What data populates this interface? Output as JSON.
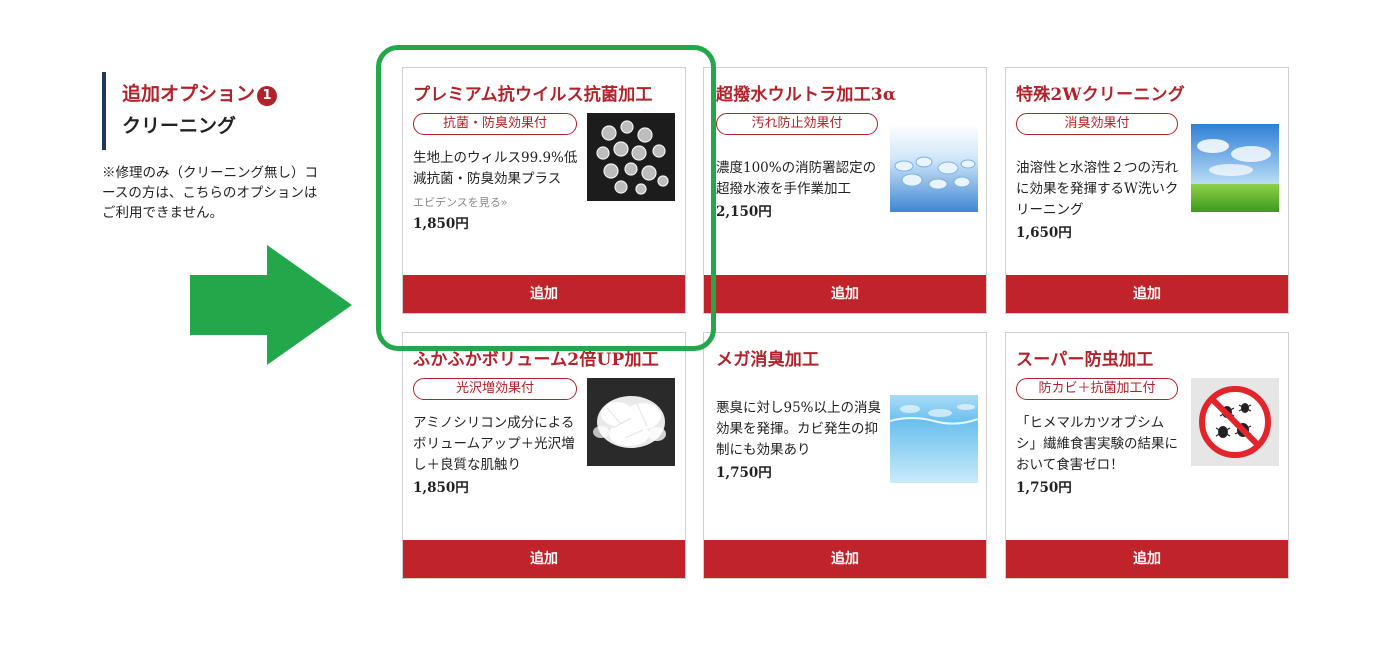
{
  "sidebar": {
    "title": "追加オプション",
    "number": "1",
    "subtitle": "クリーニング",
    "note": "※修理のみ（クリーニング無し）コースの方は、こちらのオプションはご利用できません。"
  },
  "options": [
    {
      "title": "プレミアム抗ウイルス抗菌加工",
      "badge": "抗菌・防臭効果付",
      "desc": "生地上のウィルス99.9%低減抗菌・防臭効果プラス",
      "evidence": "エビデンスを見る»",
      "price": "1,850円",
      "button": "追加",
      "image": "virus-microscope-image"
    },
    {
      "title": "超撥水ウルトラ加工3α",
      "badge": "汚れ防止効果付",
      "desc": "濃度100%の消防署認定の超撥水液を手作業加工",
      "price": "2,150円",
      "button": "追加",
      "image": "water-droplets-image"
    },
    {
      "title": "特殊2Wクリーニング",
      "badge": "消臭効果付",
      "desc": "油溶性と水溶性２つの汚れに効果を発揮するW洗いクリーニング",
      "price": "1,650円",
      "button": "追加",
      "image": "sky-grass-image"
    },
    {
      "title": "ふかふかボリューム2倍UP加工",
      "badge": "光沢増効果付",
      "desc": "アミノシリコン成分によるボリュームアップ＋光沢増し＋良質な肌触り",
      "price": "1,850円",
      "button": "追加",
      "image": "down-feather-image"
    },
    {
      "title": "メガ消臭加工",
      "badge": "",
      "desc": "悪臭に対し95%以上の消臭効果を発揮。カビ発生の抑制にも効果あり",
      "price": "1,750円",
      "button": "追加",
      "image": "water-surface-image"
    },
    {
      "title": "スーパー防虫加工",
      "badge": "防カビ＋抗菌加工付",
      "desc": "「ヒメマルカツオブシムシ」繊維食害実験の結果において食害ゼロ！",
      "price": "1,750円",
      "button": "追加",
      "image": "no-bugs-icon"
    }
  ],
  "colors": {
    "accent": "#c0232a",
    "title_red": "#b3222a",
    "navy": "#1e3560",
    "highlight_green": "#22a84a"
  }
}
